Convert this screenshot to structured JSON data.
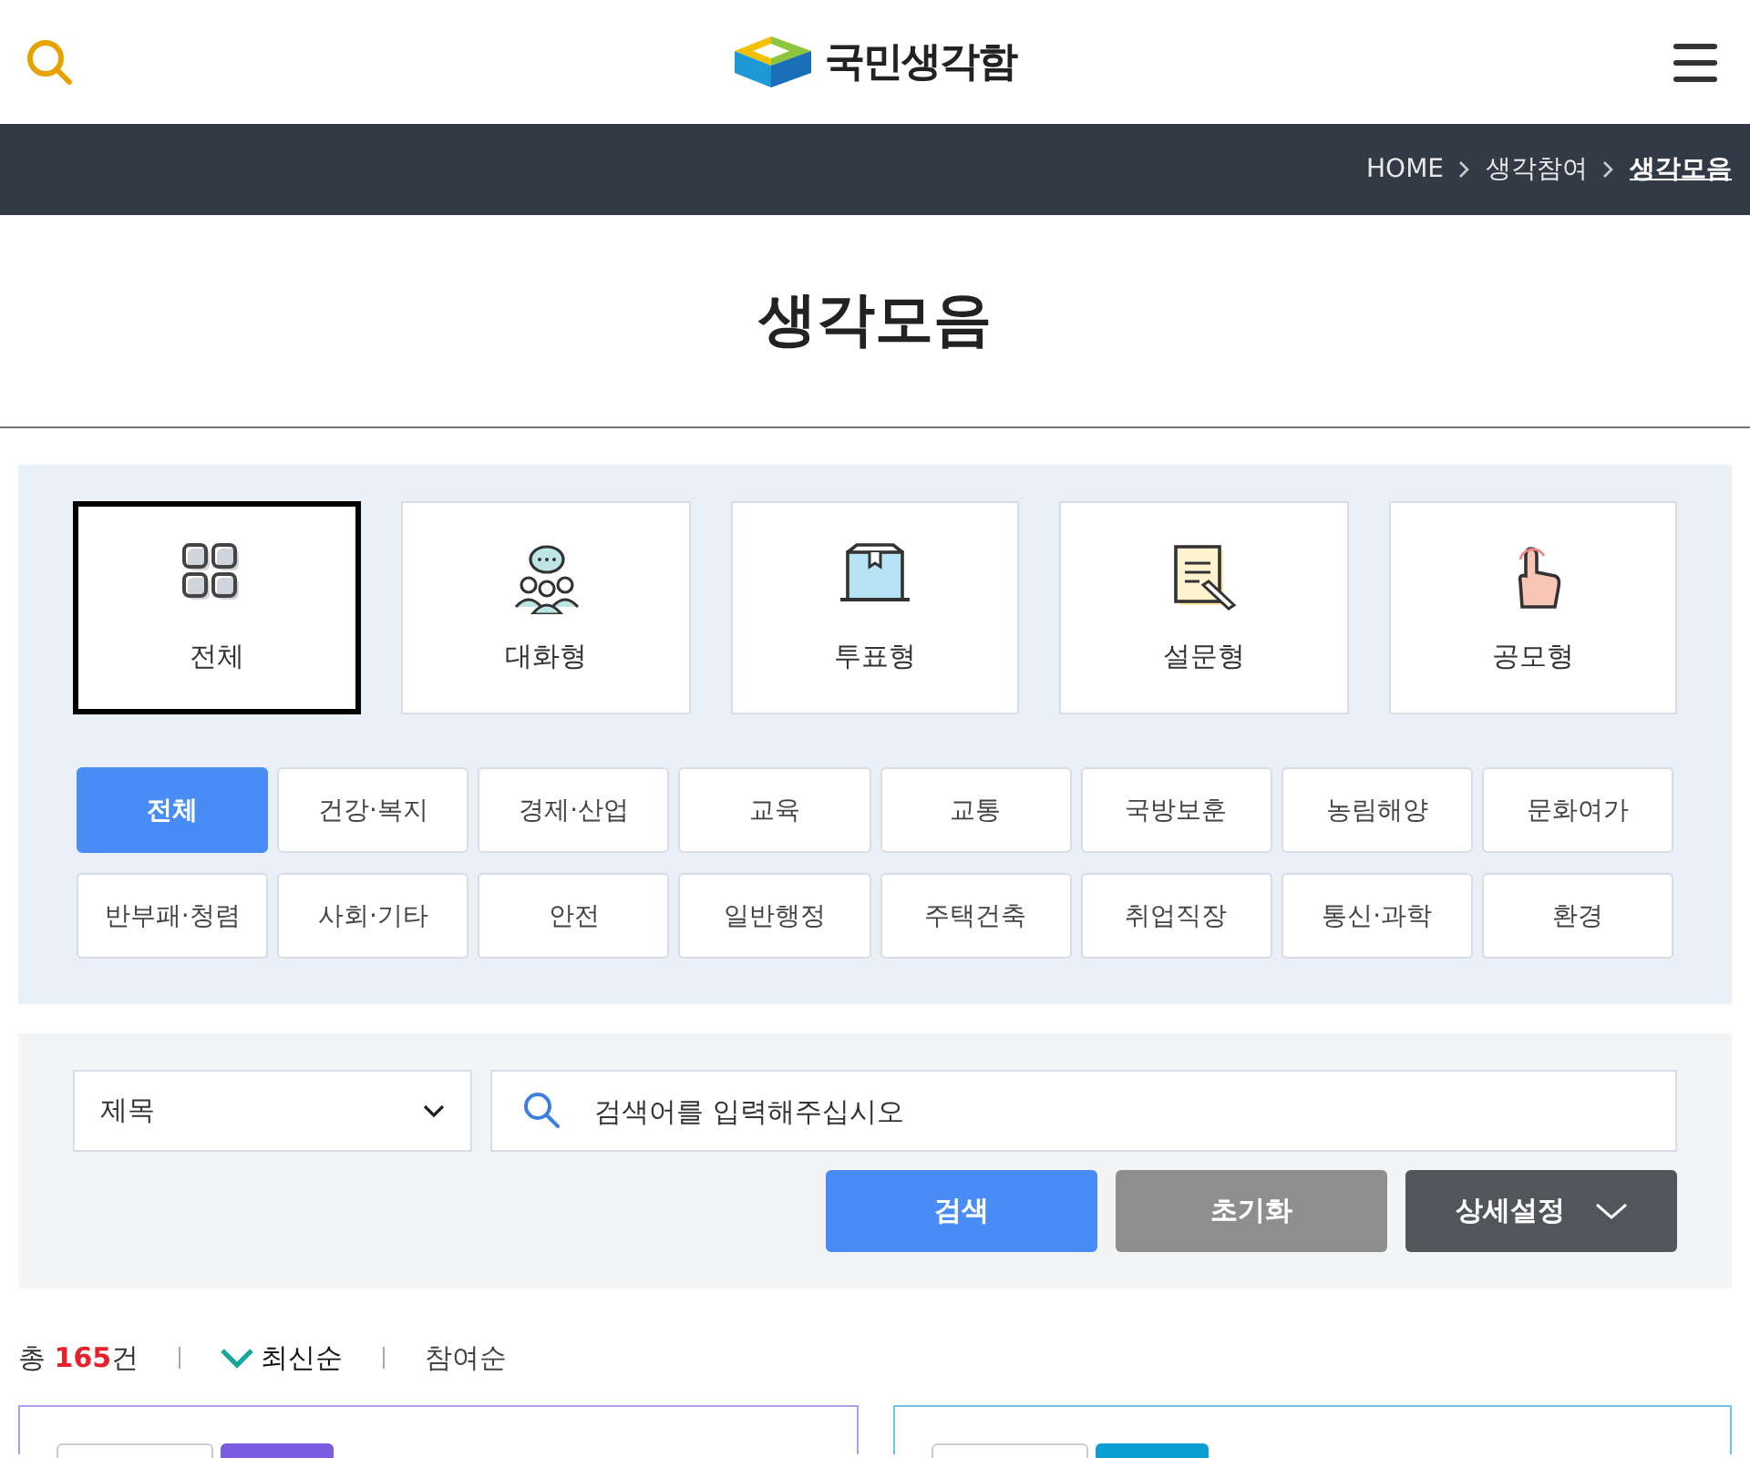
{
  "header": {
    "logo_text": "국민생각함"
  },
  "breadcrumb": [
    {
      "label": "HOME",
      "selected": false
    },
    {
      "label": "생각참여",
      "selected": false
    },
    {
      "label": "생각모음",
      "selected": true
    }
  ],
  "page_title": "생각모음",
  "types": [
    {
      "kind": "all",
      "label": "전체",
      "selected": true
    },
    {
      "kind": "chat",
      "label": "대화형",
      "selected": false
    },
    {
      "kind": "vote",
      "label": "투표형",
      "selected": false
    },
    {
      "kind": "survey",
      "label": "설문형",
      "selected": false
    },
    {
      "kind": "contest",
      "label": "공모형",
      "selected": false
    }
  ],
  "categories": [
    {
      "label": "전체",
      "selected": true
    },
    {
      "label": "건강·복지",
      "selected": false
    },
    {
      "label": "경제·산업",
      "selected": false
    },
    {
      "label": "교육",
      "selected": false
    },
    {
      "label": "교통",
      "selected": false
    },
    {
      "label": "국방보훈",
      "selected": false
    },
    {
      "label": "농림해양",
      "selected": false
    },
    {
      "label": "문화여가",
      "selected": false
    },
    {
      "label": "반부패·청렴",
      "selected": false
    },
    {
      "label": "사회·기타",
      "selected": false
    },
    {
      "label": "안전",
      "selected": false
    },
    {
      "label": "일반행정",
      "selected": false
    },
    {
      "label": "주택건축",
      "selected": false
    },
    {
      "label": "취업직장",
      "selected": false
    },
    {
      "label": "통신·과학",
      "selected": false
    },
    {
      "label": "환경",
      "selected": false
    }
  ],
  "search": {
    "field_select": "제목",
    "placeholder": "검색어를 입력해주십시오",
    "buttons": [
      {
        "kind": "primary",
        "label": "검색"
      },
      {
        "kind": "reset",
        "label": "초기화"
      },
      {
        "kind": "advanced",
        "label": "상세설정"
      }
    ]
  },
  "results": {
    "total_prefix": "총",
    "total_count": "165",
    "total_suffix": "건",
    "sort": [
      {
        "label": "최신순",
        "selected": true
      },
      {
        "label": "참여순",
        "selected": false
      }
    ]
  },
  "cards": [
    {
      "color": "#7b5ce0"
    },
    {
      "color": "#0a9fd0"
    }
  ]
}
